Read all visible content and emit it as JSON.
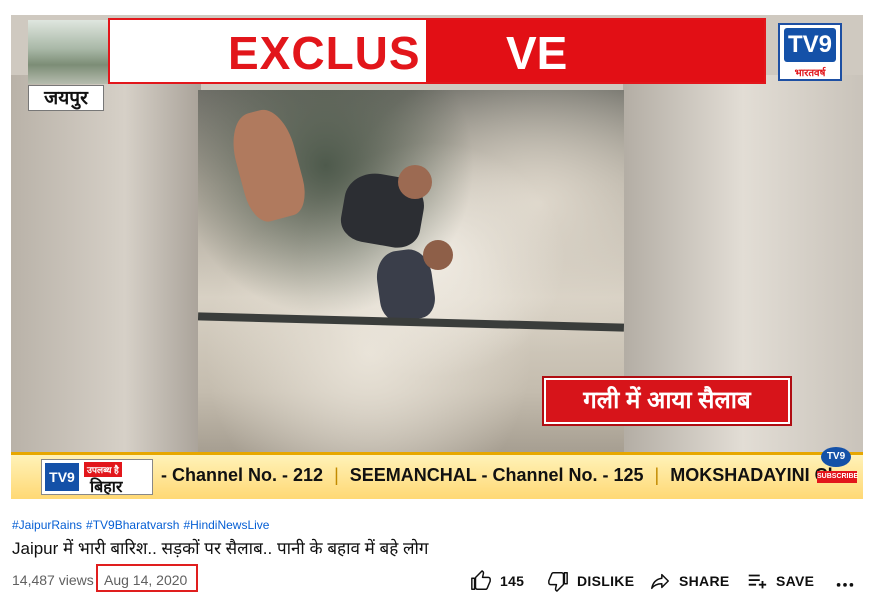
{
  "video": {
    "banner_text_left": "EXCLUS",
    "banner_text_right": "VE",
    "location": "जयपुर",
    "logo": {
      "mark": "TV9",
      "sub": "भारतवर्ष"
    },
    "caption": "गली में आया सैलाब",
    "ticker": {
      "logo_mark": "TV9",
      "logo_tag": "उपलब्ध है",
      "state": "बिहार",
      "items": [
        {
          "label": "- Channel No. -",
          "number": "212"
        },
        {
          "label": "SEEMANCHAL - Channel No. -",
          "number": "125"
        },
        {
          "label": "MOKSHADAYINI Ch",
          "number": ""
        }
      ],
      "subscribe_label": "SUBSCRIBE"
    }
  },
  "info": {
    "hashtags": [
      "#JaipurRains",
      "#TV9Bharatvarsh",
      "#HindiNewsLive"
    ],
    "title": "Jaipur में भारी बारिश.. सड़कों पर सैलाब.. पानी के बहाव में बहे लोग",
    "views": "14,487 views",
    "date": "Aug 14, 2020"
  },
  "actions": {
    "like_count": "145",
    "dislike_label": "DISLIKE",
    "share_label": "SHARE",
    "save_label": "SAVE",
    "more_label": "..."
  },
  "colors": {
    "accent_red": "#e2161b",
    "link_blue": "#065fd4",
    "ticker_yellow": "#ffd873",
    "brand_blue": "#1451a8"
  }
}
